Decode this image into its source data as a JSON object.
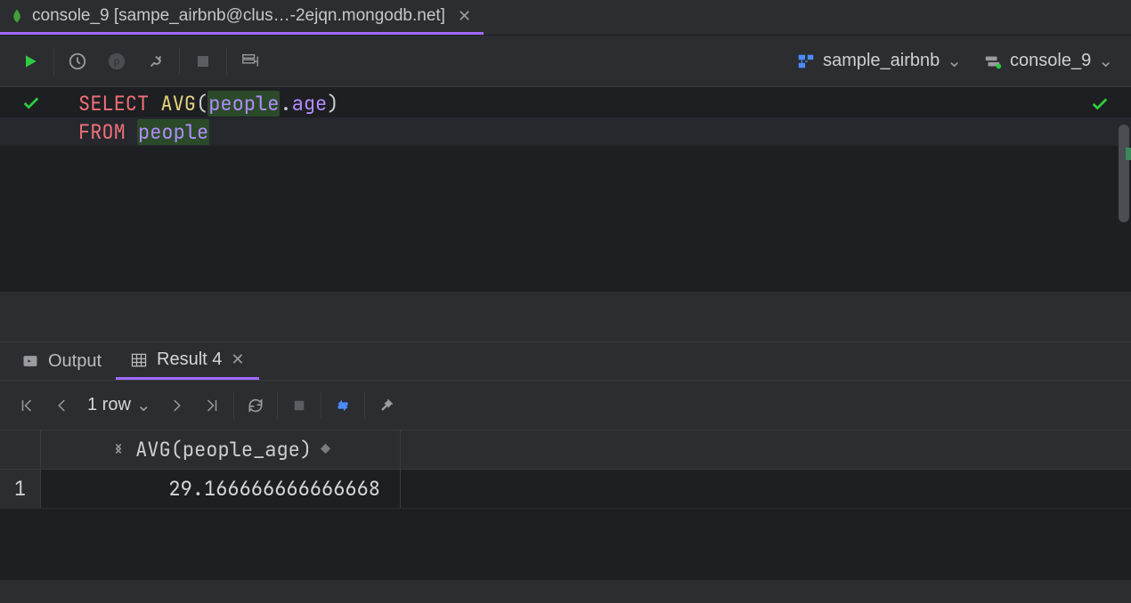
{
  "tab": {
    "title": "console_9 [sampe_airbnb@clus…-2ejqn.mongodb.net]"
  },
  "toolbar_right": {
    "db_label": "sample_airbnb",
    "session_label": "console_9"
  },
  "query": {
    "line1": {
      "select": "SELECT",
      "fn": "AVG",
      "open": "(",
      "obj": "people",
      "dot": ".",
      "field": "age",
      "close": ")"
    },
    "line2": {
      "from": "FROM",
      "table": "people"
    }
  },
  "result_tabs": {
    "output": "Output",
    "result": "Result 4"
  },
  "result_toolbar": {
    "row_count": "1 row"
  },
  "grid": {
    "column": "AVG(people_age)",
    "row_num": "1",
    "value": "29.166666666666668"
  }
}
